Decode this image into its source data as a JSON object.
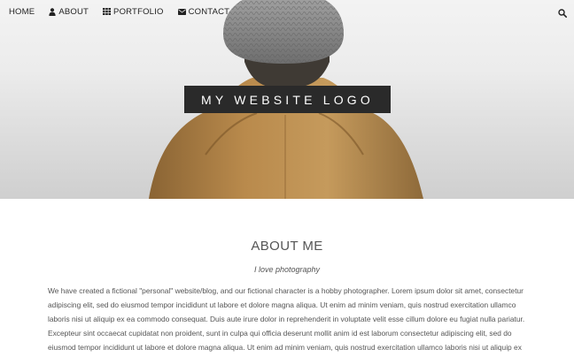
{
  "nav": {
    "items": [
      {
        "label": "HOME",
        "icon": ""
      },
      {
        "label": "ABOUT",
        "icon": "user-icon"
      },
      {
        "label": "PORTFOLIO",
        "icon": "grid-icon"
      },
      {
        "label": "CONTACT",
        "icon": "envelope-icon"
      }
    ],
    "search_icon": "search-icon"
  },
  "hero": {
    "logo_text": "MY WEBSITE LOGO"
  },
  "about": {
    "title": "ABOUT ME",
    "subtitle": "I love photography",
    "body": "We have created a fictional \"personal\" website/blog, and our fictional character is a hobby photographer. Lorem ipsum dolor sit amet, consectetur adipiscing elit, sed do eiusmod tempor incididunt ut labore et dolore magna aliqua. Ut enim ad minim veniam, quis nostrud exercitation ullamco laboris nisi ut aliquip ex ea commodo consequat. Duis aute irure dolor in reprehenderit in voluptate velit esse cillum dolore eu fugiat nulla pariatur. Excepteur sint occaecat cupidatat non proident, sunt in culpa qui officia deserunt mollit anim id est laborum consectetur adipiscing elit, sed do eiusmod tempor incididunt ut labore et dolore magna aliqua. Ut enim ad minim veniam, quis nostrud exercitation ullamco laboris nisi ut aliquip ex"
  },
  "colors": {
    "logo_bg": "#2a2a2a",
    "coat": "#b98a4c",
    "hat": "#8f8f8f"
  }
}
